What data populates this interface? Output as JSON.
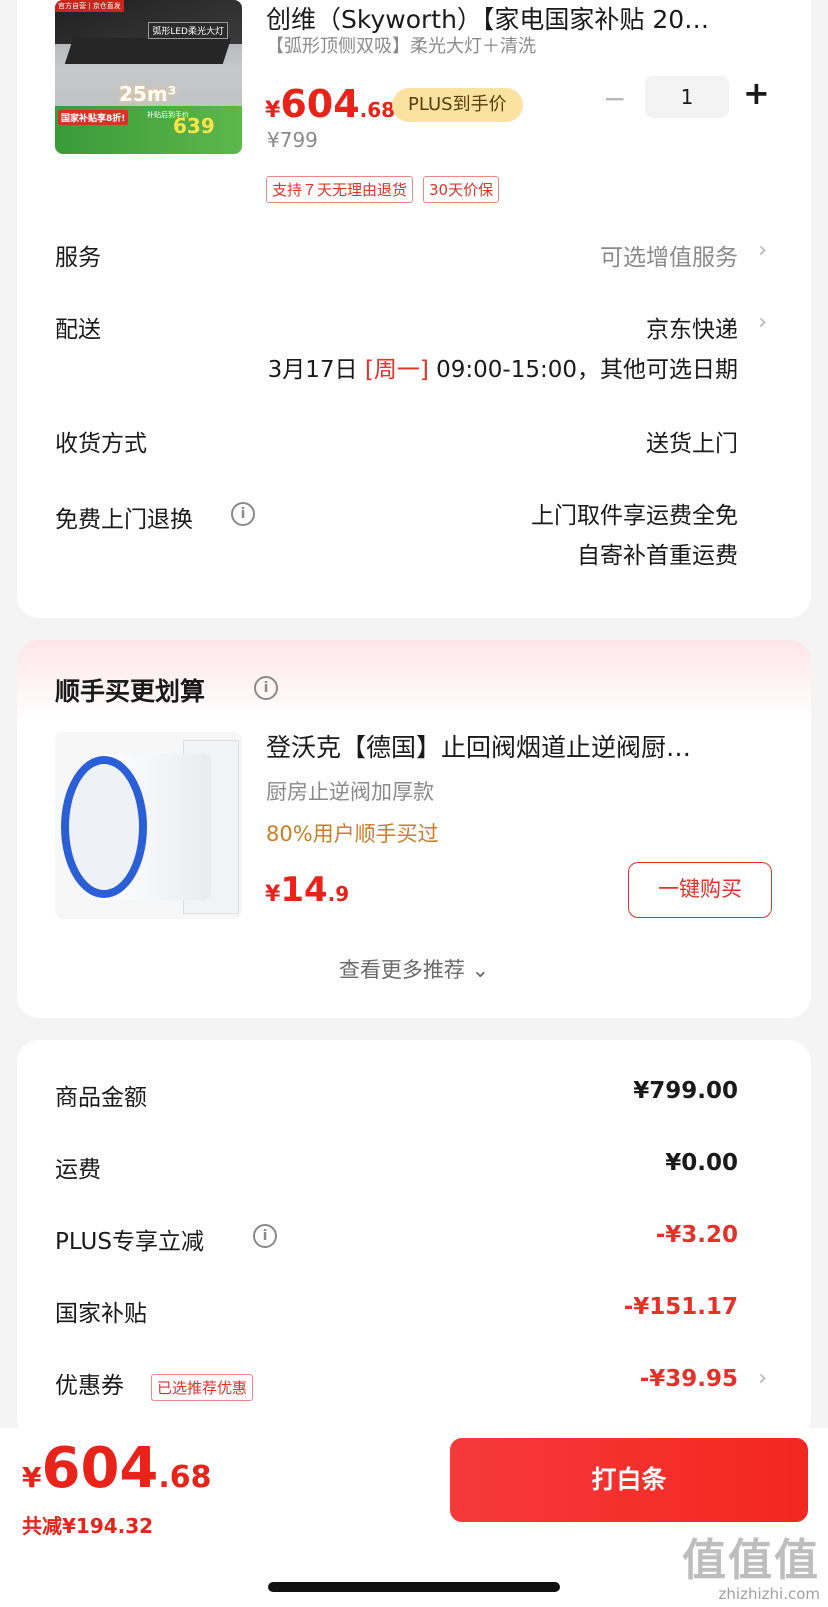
{
  "product": {
    "title": "创维（Skyworth）【家电国家补贴 20…",
    "spec": "【弧形顶侧双吸】柔光大灯＋清洗",
    "thumb": {
      "tag_top": "官方自营 | 京仓直发",
      "tag_led": "弧形LED柔光大灯",
      "flow": "25m³",
      "promo_sub": "国家补贴享8折!",
      "promo_small": "补贴后到手价",
      "promo_big": "639"
    },
    "price": {
      "yen": "¥",
      "int": "604",
      "dec": ".68"
    },
    "plus_tag": "PLUS到手价",
    "original_price": "¥799",
    "badges": [
      "支持７天无理由退货",
      "30天价保"
    ],
    "qty": {
      "minus": "−",
      "value": "1",
      "plus": "+"
    }
  },
  "service": {
    "label": "服务",
    "value": "可选增值服务"
  },
  "delivery": {
    "label": "配送",
    "value": "京东快递",
    "date": "3月17日",
    "weekday": "[周一]",
    "time": "09:00-15:00，其他可选日期"
  },
  "receive": {
    "label": "收货方式",
    "value": "送货上门"
  },
  "return": {
    "label": "免费上门退换",
    "line1": "上门取件享运费全免",
    "line2": "自寄补首重运费"
  },
  "recommend": {
    "title": "顺手买更划算",
    "name": "登沃克【德国】止回阀烟道止逆阀厨…",
    "spec": "厨房止逆阀加厚款",
    "social": "80%用户顺手买过",
    "price": {
      "yen": "¥",
      "int": "14",
      "dec": ".9"
    },
    "buy_label": "一键购买",
    "more_label": "查看更多推荐 ⌄"
  },
  "summary": {
    "rows": [
      {
        "label": "商品金额",
        "value": "¥799.00"
      },
      {
        "label": "运费",
        "value": "¥0.00"
      },
      {
        "label": "PLUS专享立减",
        "value": "-¥3.20"
      },
      {
        "label": "国家补贴",
        "value": "-¥151.17"
      },
      {
        "label": "优惠券",
        "value": "-¥39.95"
      }
    ],
    "coupon_tag": "已选推荐优惠"
  },
  "footer": {
    "total": {
      "yen": "¥",
      "int": "604",
      "dec": ".68"
    },
    "saved": "共减¥194.32",
    "pay_label": "打白条",
    "watermark_logo": "值值值",
    "watermark_site": "zhizhizhi.com"
  },
  "colors": {
    "accent": "#e8231a",
    "plus_tag_bg": "#fbe2a0",
    "social": "#c97e27"
  }
}
